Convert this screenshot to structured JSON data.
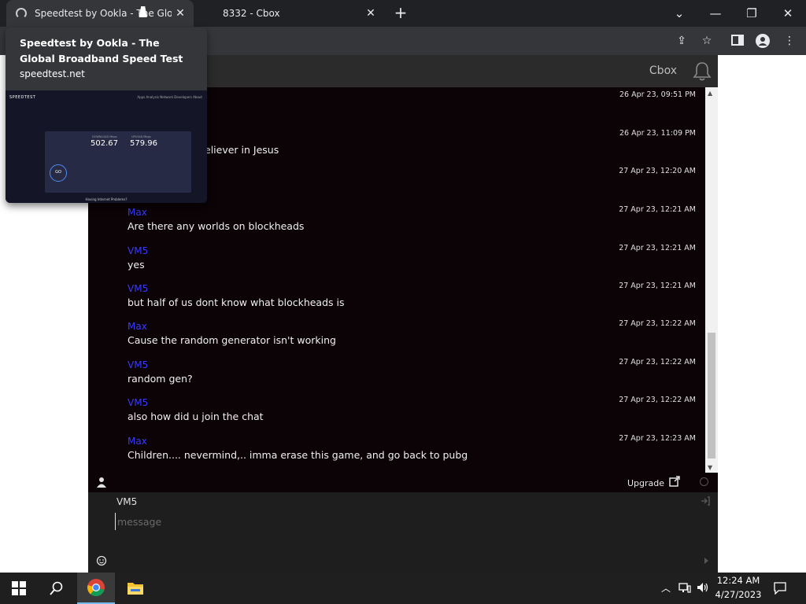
{
  "browser": {
    "tabs": [
      {
        "title": "Speedtest by Ookla - The Global Broadband Speed Test",
        "active": true
      },
      {
        "title": "8332 - Cbox",
        "active": false
      }
    ],
    "new_tab": "+",
    "preview": {
      "title": "Speedtest by Ookla - The Global Broadband Speed Test",
      "url": "speedtest.net",
      "thumb": {
        "brand": "SPEEDTEST",
        "nav": "Apps   Analysis   Network   Developers   About",
        "download": "502.67",
        "upload": "579.96",
        "download_label": "DOWNLOAD Mbps",
        "upload_label": "UPLOAD Mbps",
        "go": "GO",
        "footer": "Having Internet Problems?"
      }
    }
  },
  "cbox": {
    "title": "Cbox",
    "messages": [
      {
        "name": "",
        "time": "26 Apr 23, 09:51 PM",
        "text": ""
      },
      {
        "name": "",
        "time": "26 Apr 23, 11:09 PM",
        "text": "eliever in Jesus"
      },
      {
        "name": "",
        "time": "27 Apr 23, 12:20 AM",
        "text": ""
      },
      {
        "name": "Max",
        "time": "27 Apr 23, 12:21 AM",
        "text": "Are there any worlds on blockheads"
      },
      {
        "name": "VM5",
        "time": "27 Apr 23, 12:21 AM",
        "text": "yes"
      },
      {
        "name": "VM5",
        "time": "27 Apr 23, 12:21 AM",
        "text": "but half of us dont know what blockheads is"
      },
      {
        "name": "Max",
        "time": "27 Apr 23, 12:22 AM",
        "text": "Cause the random generator isn't working"
      },
      {
        "name": "VM5",
        "time": "27 Apr 23, 12:22 AM",
        "text": "random gen?"
      },
      {
        "name": "VM5",
        "time": "27 Apr 23, 12:22 AM",
        "text": "also how did u join the chat"
      },
      {
        "name": "Max",
        "time": "27 Apr 23, 12:23 AM",
        "text": "Children.... nevermind,.. imma erase this game, and go back to pubg"
      }
    ],
    "status": {
      "upgrade_label": "Upgrade"
    },
    "composer": {
      "name": "VM5",
      "placeholder": "message"
    }
  },
  "taskbar": {
    "time": "12:24 AM",
    "date": "4/27/2023"
  },
  "colors": {
    "chat_bg": "#0b0306",
    "username": "#3a3aff",
    "chrome_dark": "#202124"
  }
}
